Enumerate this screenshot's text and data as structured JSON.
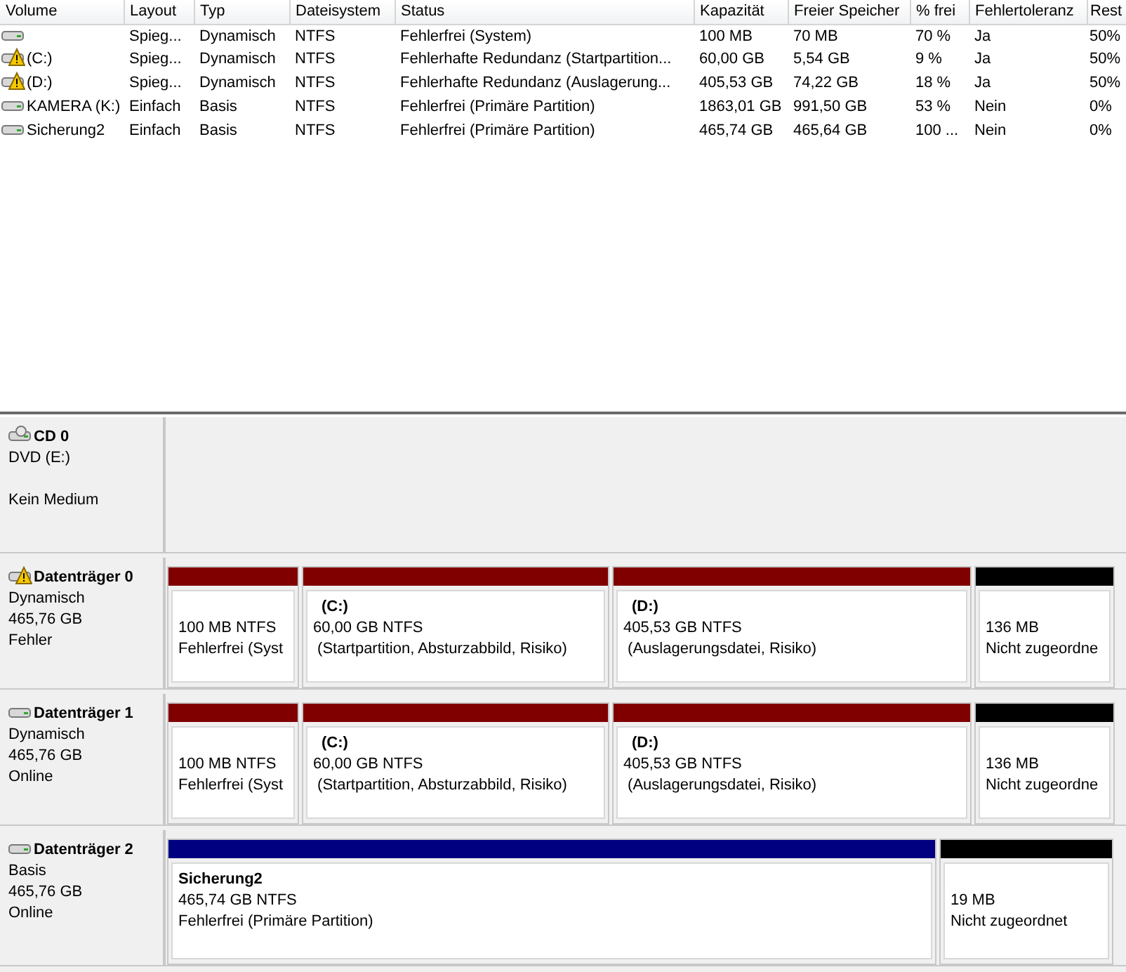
{
  "volume_table": {
    "columns": [
      "Volume",
      "Layout",
      "Typ",
      "Dateisystem",
      "Status",
      "Kapazität",
      "Freier Speicher",
      "% frei",
      "Fehlertoleranz",
      "Rest"
    ],
    "rows": [
      {
        "warning": false,
        "cells": [
          "",
          "Spieg...",
          "Dynamisch",
          "NTFS",
          "Fehlerfrei (System)",
          "100 MB",
          "70 MB",
          "70 %",
          "Ja",
          "50%"
        ]
      },
      {
        "warning": true,
        "cells": [
          "(C:)",
          "Spieg...",
          "Dynamisch",
          "NTFS",
          "Fehlerhafte Redundanz (Startpartition...",
          "60,00 GB",
          "5,54 GB",
          "9 %",
          "Ja",
          "50%"
        ]
      },
      {
        "warning": true,
        "cells": [
          "(D:)",
          "Spieg...",
          "Dynamisch",
          "NTFS",
          "Fehlerhafte Redundanz (Auslagerung...",
          "405,53 GB",
          "74,22 GB",
          "18 %",
          "Ja",
          "50%"
        ]
      },
      {
        "warning": false,
        "cells": [
          "KAMERA (K:)",
          "Einfach",
          "Basis",
          "NTFS",
          "Fehlerfrei (Primäre Partition)",
          "1863,01 GB",
          "991,50 GB",
          "53 %",
          "Nein",
          "0%"
        ]
      },
      {
        "warning": false,
        "cells": [
          "Sicherung2",
          "Einfach",
          "Basis",
          "NTFS",
          "Fehlerfrei (Primäre Partition)",
          "465,74 GB",
          "465,64 GB",
          "100 ...",
          "Nein",
          "0%"
        ]
      }
    ]
  },
  "disks": [
    {
      "kind": "cdrom",
      "warning": false,
      "name": "CD 0",
      "lines": [
        "DVD (E:)",
        "Kein Medium"
      ]
    },
    {
      "kind": "disk",
      "warning": true,
      "name": "Datenträger 0",
      "lines": [
        "Dynamisch",
        "465,76 GB",
        "Fehler"
      ],
      "partitions": [
        {
          "color": "#800000",
          "size": "100 MB NTFS",
          "status": "Fehlerfrei (Syst"
        },
        {
          "color": "#800000",
          "name": "(C:)",
          "size": "60,00 GB NTFS",
          "status": " (Startpartition, Absturzabbild, Risiko)"
        },
        {
          "color": "#800000",
          "name": "(D:)",
          "size": "405,53 GB NTFS",
          "status": " (Auslagerungsdatei, Risiko)"
        },
        {
          "color": "#000000",
          "size": "136 MB",
          "status": "Nicht zugeordne"
        }
      ]
    },
    {
      "kind": "disk",
      "warning": false,
      "name": "Datenträger 1",
      "lines": [
        "Dynamisch",
        "465,76 GB",
        "Online"
      ],
      "partitions": [
        {
          "color": "#800000",
          "size": "100 MB NTFS",
          "status": "Fehlerfrei (Syst"
        },
        {
          "color": "#800000",
          "name": "(C:)",
          "size": "60,00 GB NTFS",
          "status": " (Startpartition, Absturzabbild, Risiko)"
        },
        {
          "color": "#800000",
          "name": "(D:)",
          "size": "405,53 GB NTFS",
          "status": " (Auslagerungsdatei, Risiko)"
        },
        {
          "color": "#000000",
          "size": "136 MB",
          "status": "Nicht zugeordne"
        }
      ]
    },
    {
      "kind": "disk",
      "warning": false,
      "name": "Datenträger 2",
      "lines": [
        "Basis",
        "465,76 GB",
        "Online"
      ],
      "partitions": [
        {
          "color": "#000080",
          "name": "Sicherung2",
          "size": "465,74 GB NTFS",
          "status": "Fehlerfrei (Primäre Partition)"
        },
        {
          "color": "#000000",
          "size": "19 MB",
          "status": "Nicht zugeordnet"
        }
      ]
    }
  ]
}
